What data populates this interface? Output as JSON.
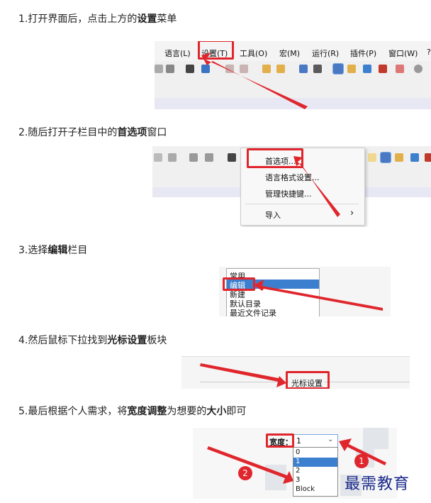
{
  "steps": [
    {
      "prefix": "1.打开界面后，点击上方的",
      "bold": "设置",
      "suffix": "菜单"
    },
    {
      "prefix": "2.随后打开子栏目中的",
      "bold": "首选项",
      "suffix": "窗口"
    },
    {
      "prefix": "3.选择",
      "bold": "编辑",
      "suffix": "栏目"
    },
    {
      "prefix": "4.然后鼠标下拉找到",
      "bold": "光标设置",
      "suffix": "板块"
    },
    {
      "prefix": "5.最后根据个人需求，将",
      "bold": "宽度调整",
      "suffix": "为想要的",
      "bold2": "大小",
      "suffix2": "即可"
    }
  ],
  "shot1": {
    "menu": [
      "语言(L)",
      "设置(T)",
      "工具(O)",
      "宏(M)",
      "运行(R)",
      "插件(P)",
      "窗口(W)",
      "?"
    ]
  },
  "shot2": {
    "items": [
      "首选项...",
      "语言格式设置...",
      "管理快捷键...",
      "导入"
    ],
    "submenu_arrow": "›"
  },
  "shot3": {
    "list": [
      "常用",
      "编辑",
      "新建",
      "默认目录",
      "最近文件记录"
    ]
  },
  "shot4": {
    "section": "光标设置"
  },
  "shot5": {
    "label": "宽度：",
    "selected": "1",
    "options": [
      "0",
      "1",
      "2",
      "3",
      "Block"
    ],
    "badge1": "1",
    "badge2": "2"
  },
  "watermark": "最需教育",
  "colors": {
    "red": "#e0262d",
    "selection": "#3d7fcf"
  }
}
